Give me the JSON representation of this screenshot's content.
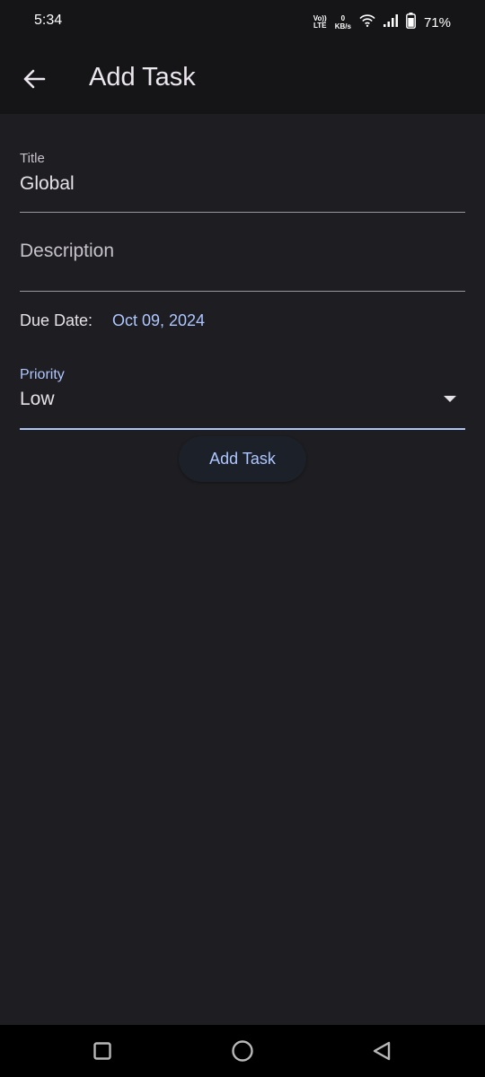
{
  "status_bar": {
    "time": "5:34",
    "volte_top": "Vo))",
    "volte_bottom": "LTE",
    "net_speed_value": "0",
    "net_speed_unit": "KB/s",
    "battery_percent": "71%"
  },
  "app_bar": {
    "title": "Add Task",
    "back_icon": "arrow-back-icon"
  },
  "form": {
    "title_field": {
      "label": "Title",
      "value": "Global"
    },
    "description_field": {
      "placeholder": "Description",
      "value": ""
    },
    "due_date": {
      "label": "Due Date:",
      "value": "Oct 09, 2024"
    },
    "priority": {
      "label": "Priority",
      "selected": "Low"
    },
    "submit_label": "Add Task"
  },
  "colors": {
    "background": "#1e1e22",
    "bar_background": "#151518",
    "accent": "#aec6ff"
  },
  "nav_bar": {
    "icons": [
      "recents-square-icon",
      "home-circle-icon",
      "back-triangle-icon"
    ]
  }
}
